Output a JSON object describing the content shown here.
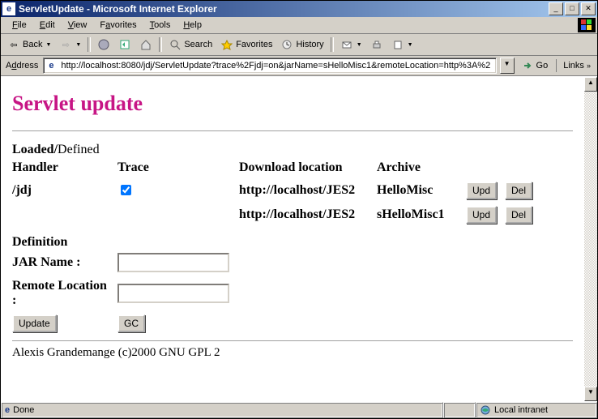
{
  "window": {
    "title": "ServletUpdate - Microsoft Internet Explorer"
  },
  "menubar": {
    "file": "File",
    "edit": "Edit",
    "view": "View",
    "favorites": "Favorites",
    "tools": "Tools",
    "help": "Help"
  },
  "toolbar": {
    "back": "Back",
    "search": "Search",
    "favorites": "Favorites",
    "history": "History"
  },
  "addressbar": {
    "label": "Address",
    "url": "http://localhost:8080/jdj/ServletUpdate?trace%2Fjdj=on&jarName=sHelloMisc1&remoteLocation=http%3A%2",
    "go": "Go",
    "links": "Links"
  },
  "page": {
    "heading": "Servlet update",
    "loaded": "Loaded",
    "defined": "Defined",
    "cols": {
      "handler": "Handler",
      "trace": "Trace",
      "download": "Download location",
      "archive": "Archive"
    },
    "rows": [
      {
        "handler": "/jdj",
        "trace": true,
        "download": "http://localhost/JES2",
        "archive": "HelloMisc"
      },
      {
        "handler": "",
        "trace": null,
        "download": "http://localhost/JES2",
        "archive": "sHelloMisc1"
      }
    ],
    "btn_upd": "Upd",
    "btn_del": "Del",
    "definition": "Definition",
    "jar_label": "JAR Name :",
    "remote_label": "Remote Location :",
    "btn_update": "Update",
    "btn_gc": "GC",
    "footer": "Alexis Grandemange (c)2000 GNU GPL 2"
  },
  "statusbar": {
    "status": "Done",
    "zone": "Local intranet"
  }
}
